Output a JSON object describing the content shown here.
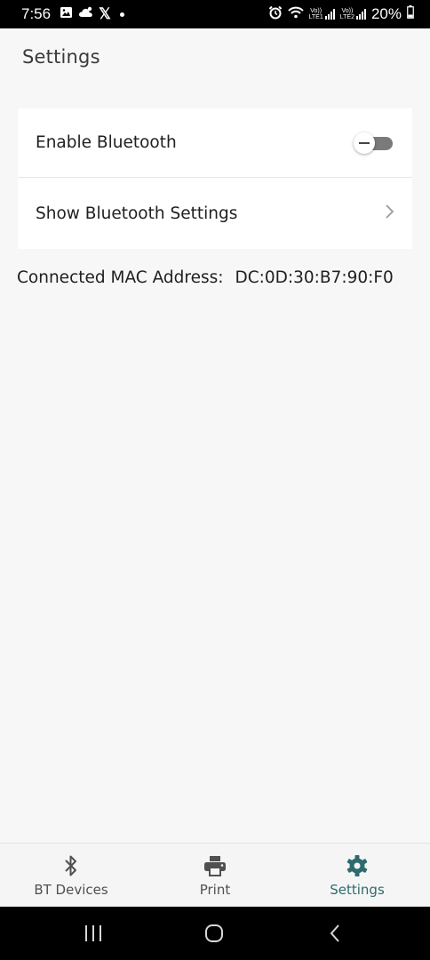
{
  "status_bar": {
    "time": "7:56",
    "left_icons": [
      "image-icon",
      "cloud-icon",
      "x-app-icon",
      "notification-dot-icon"
    ],
    "right_icons": [
      "alarm-icon",
      "wifi-icon",
      "signal-sim1-icon",
      "signal-sim2-icon",
      "battery-icon"
    ],
    "sim1_label_top": "Vo))",
    "sim1_label_bottom": "LTE1",
    "sim2_label_top": "Vo))",
    "sim2_label_bottom": "LTE2",
    "battery": "20%"
  },
  "page": {
    "title": "Settings"
  },
  "settings": {
    "enable_bluetooth_label": "Enable Bluetooth",
    "enable_bluetooth_on": false,
    "show_bt_settings_label": "Show Bluetooth Settings"
  },
  "connection": {
    "mac_label": "Connected MAC Address:",
    "mac_value": "DC:0D:30:B7:90:F0"
  },
  "bottom_nav": {
    "items": [
      {
        "label": "BT Devices",
        "icon": "bluetooth-icon",
        "active": false
      },
      {
        "label": "Print",
        "icon": "printer-icon",
        "active": false
      },
      {
        "label": "Settings",
        "icon": "gear-icon",
        "active": true
      }
    ],
    "active_color": "#2e6b6e",
    "inactive_color": "#505050"
  },
  "system_nav": {
    "buttons": [
      "recents-icon",
      "home-icon",
      "back-icon"
    ]
  }
}
